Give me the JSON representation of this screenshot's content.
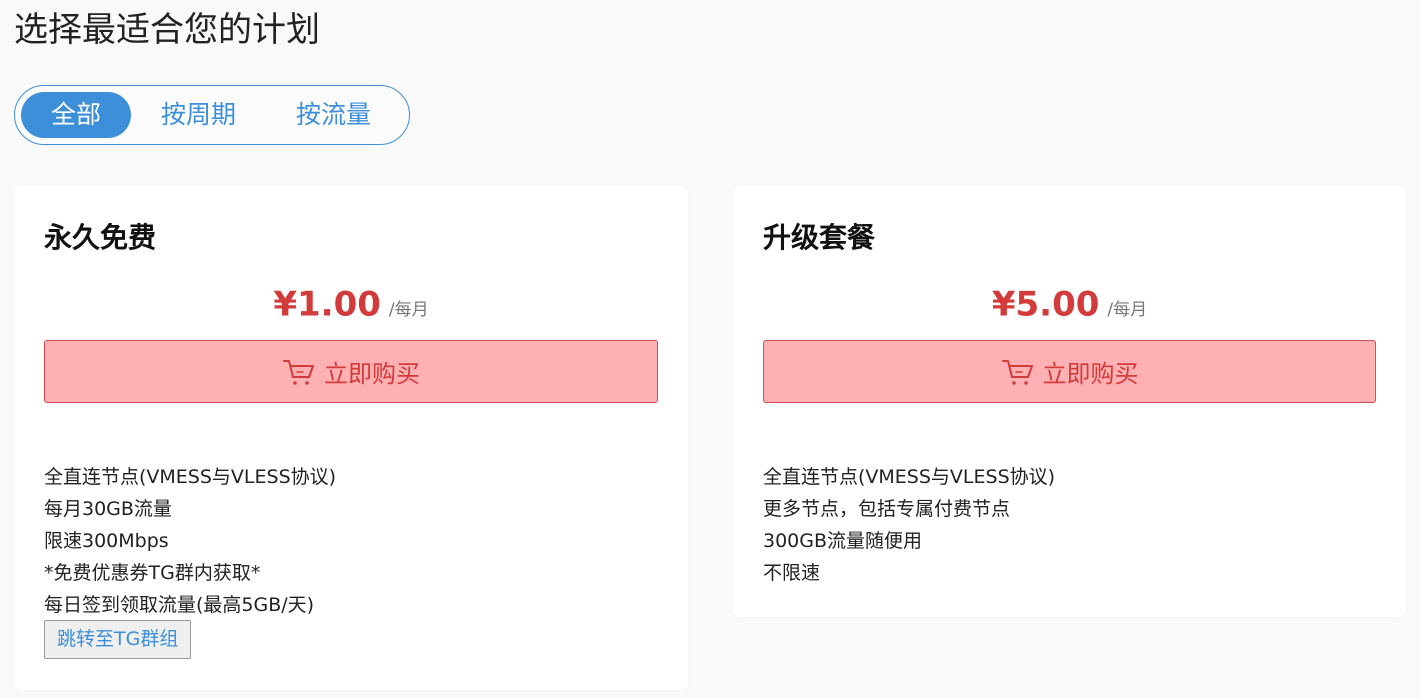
{
  "page": {
    "title": "选择最适合您的计划"
  },
  "tabs": [
    {
      "label": "全部",
      "active": true
    },
    {
      "label": "按周期",
      "active": false
    },
    {
      "label": "按流量",
      "active": false
    }
  ],
  "plans": [
    {
      "name": "永久免费",
      "price": "¥1.00",
      "period": "/每月",
      "buy_label": "立即购买",
      "features": [
        "全直连节点(VMESS与VLESS协议)",
        "每月30GB流量",
        "限速300Mbps",
        "*免费优惠券TG群内获取*",
        "每日签到领取流量(最高5GB/天)"
      ],
      "extra_button": "跳转至TG群组"
    },
    {
      "name": "升级套餐",
      "price": "¥5.00",
      "period": "/每月",
      "buy_label": "立即购买",
      "features": [
        "全直连节点(VMESS与VLESS协议)",
        "更多节点，包括专属付费节点",
        "300GB流量随便用",
        "不限速"
      ]
    }
  ],
  "icons": {
    "cart": "shopping-cart-icon"
  },
  "colors": {
    "accent_blue": "#3d8fd9",
    "price_red": "#d33a3a",
    "buy_bg": "#ffb0b3",
    "buy_border": "#d44d52",
    "page_bg": "#f9f9f9"
  }
}
